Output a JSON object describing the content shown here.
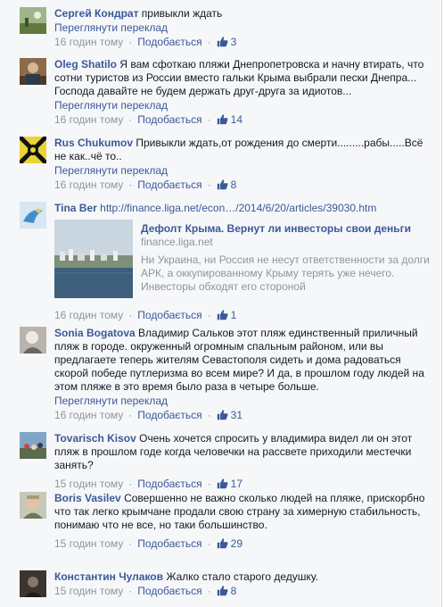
{
  "ui": {
    "translate_label": "Переглянути переклад",
    "like_label": "Подобається",
    "dot": "·"
  },
  "colors": {
    "link": "#3b5998",
    "meta": "#90949c",
    "background": "#f6f7f9",
    "text": "#141823"
  },
  "comments": [
    {
      "author": "Сергей Кондрат",
      "text": "привыкли ждать",
      "time": "16 годин тому",
      "likes": "3",
      "avatar_icon": "landscape-avatar"
    },
    {
      "author": "Oleg Shatilo",
      "text": "Я вам сфоткаю пляжи Днепропетровска и начну втирать, что сотни туристов из России вместо гальки Крыма выбрали пески Днепра... Господа давайте не будем держать друг-друга за идиотов...",
      "time": "16 годин тому",
      "likes": "14",
      "avatar_icon": "person-avatar"
    },
    {
      "author": "Rus Chukumov",
      "text": "Привыкли ждать,от рождения до смерти.........рабы.....Всё не как..чё то..",
      "time": "16 годин тому",
      "likes": "8",
      "avatar_icon": "emblem-avatar"
    },
    {
      "author": "Tina Ber",
      "text": "http://finance.liga.net/econ…/2014/6/20/articles/39030.htm",
      "time": "16 годин тому",
      "likes": "1",
      "avatar_icon": "bird-avatar",
      "preview": {
        "title": "Дефолт Крыма. Вернут ли инвесторы свои деньги",
        "domain": "finance.liga.net",
        "description": "Ни Украина, ни Россия не несут ответственности за долги АРК, а оккупированному Крыму терять уже нечего. Инвесторы обходят его стороной",
        "image_icon": "coastal-city-image"
      }
    },
    {
      "author": "Sonia Bogatova",
      "text": "Владимир Сальков этот пляж единственный приличный пляж в городе. окруженный огромным спальным районом, или вы предлагаете теперь жителям Севастополя сидеть и дома радоваться скорой победе путлеризма во всем мире? И да, в прошлом году людей на этом пляже в это время было раза в четыре больше.",
      "time": "16 годин тому",
      "likes": "31",
      "avatar_icon": "profile-avatar"
    },
    {
      "author": "Tovarisch Kisov",
      "text": "Очень хочется спросить у владимира видел ли он этот пляж в прошлом годе когда человечки на рассвете приходили местечки занять?",
      "time": "15 годин тому",
      "likes": "17",
      "avatar_icon": "crowd-avatar"
    },
    {
      "author": "Boris Vasilev",
      "text": "Совершенно не важно сколько людей на пляже, прискорбно что так легко крымчане продали свою страну за химерную стабильность, понимаю что не все, но таки большинство.",
      "time": "15 годин тому",
      "likes": "29",
      "avatar_icon": "man-avatar"
    },
    {
      "author": "Константин Чулаков",
      "text": "Жалко стало старого дедушку.",
      "time": "15 годин тому",
      "likes": "8",
      "avatar_icon": "dark-avatar"
    }
  ]
}
